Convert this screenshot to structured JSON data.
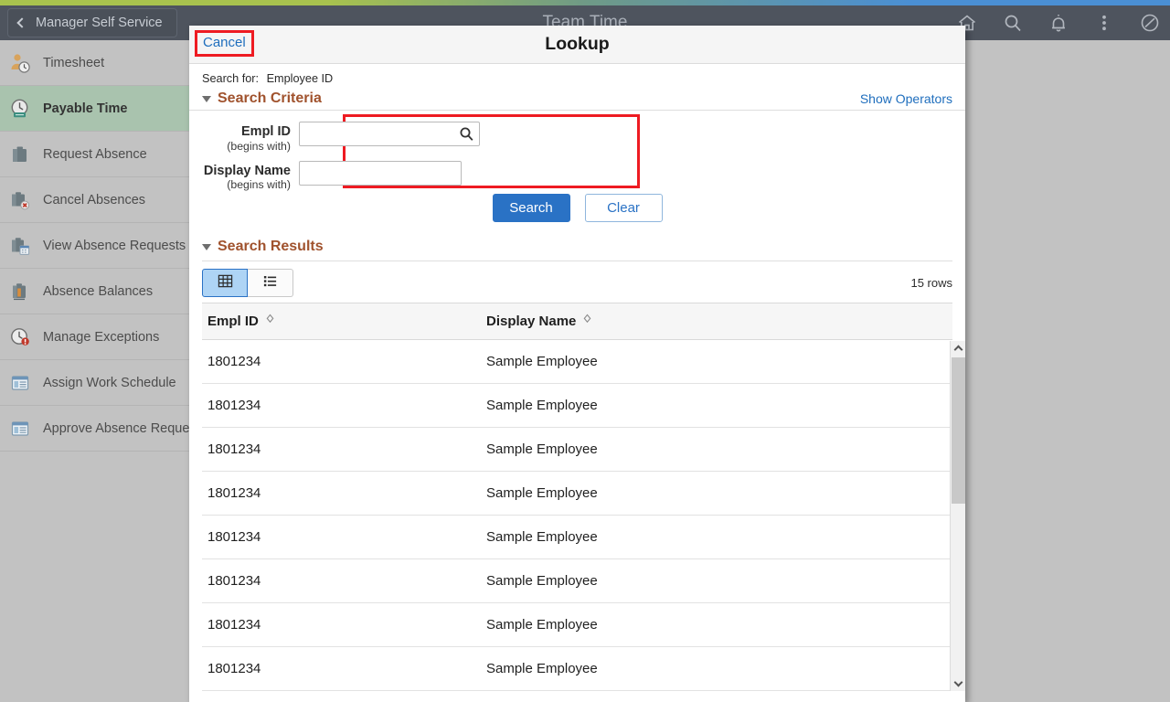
{
  "header": {
    "back_label": "Manager Self Service",
    "title": "Team Time",
    "icons": [
      {
        "name": "home-icon",
        "label": "Home"
      },
      {
        "name": "search-icon",
        "label": "Search"
      },
      {
        "name": "notifications-bell-icon",
        "label": "Notifications"
      },
      {
        "name": "kebab-menu-icon",
        "label": "Actions"
      },
      {
        "name": "nav-bar-icon",
        "label": "NavBar"
      }
    ],
    "strip_colors": {
      "left": "#a8c24e",
      "right": "#4a8fd4"
    },
    "bar_color": "#4e545e"
  },
  "sidebar": {
    "items": [
      {
        "label": "Timesheet",
        "icon": "person-clock-icon",
        "active": false
      },
      {
        "label": "Payable Time",
        "icon": "clock-icon",
        "active": true
      },
      {
        "label": "Request Absence",
        "icon": "briefcase-icon",
        "active": false
      },
      {
        "label": "Cancel Absences",
        "icon": "briefcase-cancel-icon",
        "active": false
      },
      {
        "label": "View Absence Requests",
        "icon": "briefcase-calendar-icon",
        "active": false
      },
      {
        "label": "Absence Balances",
        "icon": "briefcase-balance-icon",
        "active": false
      },
      {
        "label": "Manage Exceptions",
        "icon": "clock-alert-icon",
        "active": false
      },
      {
        "label": "Assign Work Schedule",
        "icon": "window-list-icon",
        "active": false
      },
      {
        "label": "Approve Absence Requests",
        "icon": "window-list-icon",
        "active": false
      }
    ],
    "active_color": "#a9c3ae"
  },
  "modal": {
    "cancel_label": "Cancel",
    "title": "Lookup",
    "search_for_label": "Search for:",
    "search_for_value": "Employee ID",
    "criteria": {
      "section_title": "Search Criteria",
      "show_operators_label": "Show Operators",
      "fields": [
        {
          "name": "empl-id",
          "label": "Empl ID",
          "sublabel": "(begins with)",
          "value": "",
          "placeholder": "",
          "has_lookup_icon": true
        },
        {
          "name": "display-name",
          "label": "Display Name",
          "sublabel": "(begins with)",
          "value": "",
          "placeholder": "",
          "has_lookup_icon": false
        }
      ],
      "search_button": "Search",
      "clear_button": "Clear",
      "highlight_color": "#ee1b22"
    },
    "results": {
      "section_title": "Search Results",
      "view_grid_icon": "grid-view-icon",
      "view_list_icon": "list-view-icon",
      "active_view": "grid",
      "rows_count_label": "15 rows",
      "columns": [
        {
          "key": "empl_id",
          "label": "Empl ID",
          "sortable": true
        },
        {
          "key": "display_name",
          "label": "Display Name",
          "sortable": true
        }
      ],
      "rows": [
        {
          "empl_id": "1801234",
          "display_name": "Sample Employee"
        },
        {
          "empl_id": "1801234",
          "display_name": "Sample Employee"
        },
        {
          "empl_id": "1801234",
          "display_name": "Sample Employee"
        },
        {
          "empl_id": "1801234",
          "display_name": "Sample Employee"
        },
        {
          "empl_id": "1801234",
          "display_name": "Sample Employee"
        },
        {
          "empl_id": "1801234",
          "display_name": "Sample Employee"
        },
        {
          "empl_id": "1801234",
          "display_name": "Sample Employee"
        },
        {
          "empl_id": "1801234",
          "display_name": "Sample Employee"
        }
      ]
    }
  },
  "colors": {
    "accent_blue": "#2a72c5",
    "section_orange": "#a0522d",
    "link_blue": "#1f6ebd"
  }
}
